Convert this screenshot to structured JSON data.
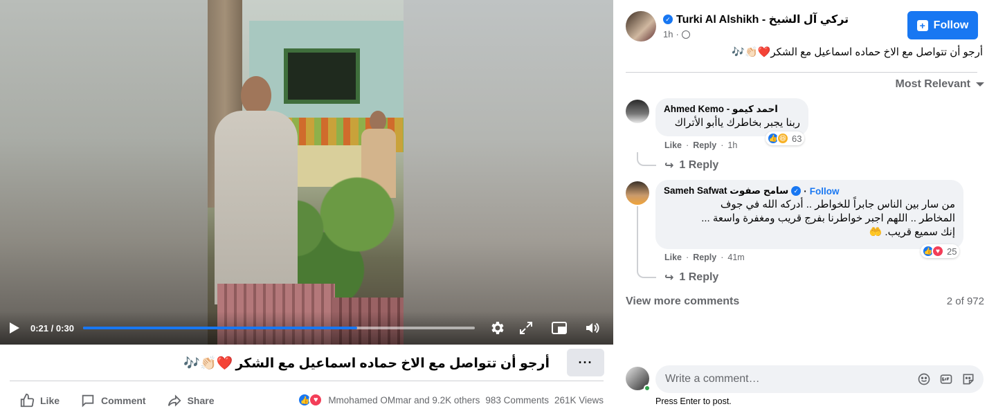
{
  "video": {
    "time_current": "0:21",
    "time_total": "0:30",
    "time_separator": "/",
    "progress": 0.7,
    "icons": [
      "play-icon",
      "settings-icon",
      "fullscreen-icon",
      "picture-in-picture-icon",
      "volume-icon"
    ]
  },
  "post": {
    "title": "أرجو أن تتواصل مع الاخ حماده اسماعيل مع الشكر",
    "title_emojis": "❤️👏🏻🎶",
    "more_label": "···",
    "actions": {
      "like": "Like",
      "comment": "Comment",
      "share": "Share"
    },
    "reactions_text": "Mmohamed OMmar and 9.2K others",
    "comments_count": "983 Comments",
    "views_count": "261K Views"
  },
  "header": {
    "author": "Turki Al Alshikh - تركي آل الشيخ",
    "time": "1h",
    "follow_label": "Follow",
    "caption": "أرجو أن تتواصل مع الاخ حماده اسماعيل مع الشكر❤️👏🏻🎶"
  },
  "sort": {
    "label": "Most Relevant"
  },
  "comments": [
    {
      "name": "Ahmed Kemo - احمد كيمو",
      "text": "ربنا يجبر بخاطرك ياأبو الأتراك",
      "like": "Like",
      "reply": "Reply",
      "time": "1h",
      "reaction_count": "63",
      "replies_label": "1 Reply"
    },
    {
      "name": "Sameh Safwat سامح صفوت",
      "follow": "Follow",
      "text_lines": [
        "من سار بين الناس جابراً للخواطر .. أدركه الله في جوف",
        "المخاطر .. اللهم اجبر خواطرنا بفرج قريب ومغفرة واسعة ...",
        "إنك سميع قريب. 🤲"
      ],
      "like": "Like",
      "reply": "Reply",
      "time": "41m",
      "reaction_count": "25",
      "replies_label": "1 Reply"
    }
  ],
  "view_more": "View more comments",
  "pagination": "2 of 972",
  "composer": {
    "placeholder": "Write a comment…",
    "hint": "Press Enter to post."
  },
  "colors": {
    "accent": "#1877f2",
    "love": "#f33e58",
    "haha": "#f7b125",
    "muted": "#65676b",
    "bubble": "#f0f2f5",
    "online": "#31a24c"
  }
}
